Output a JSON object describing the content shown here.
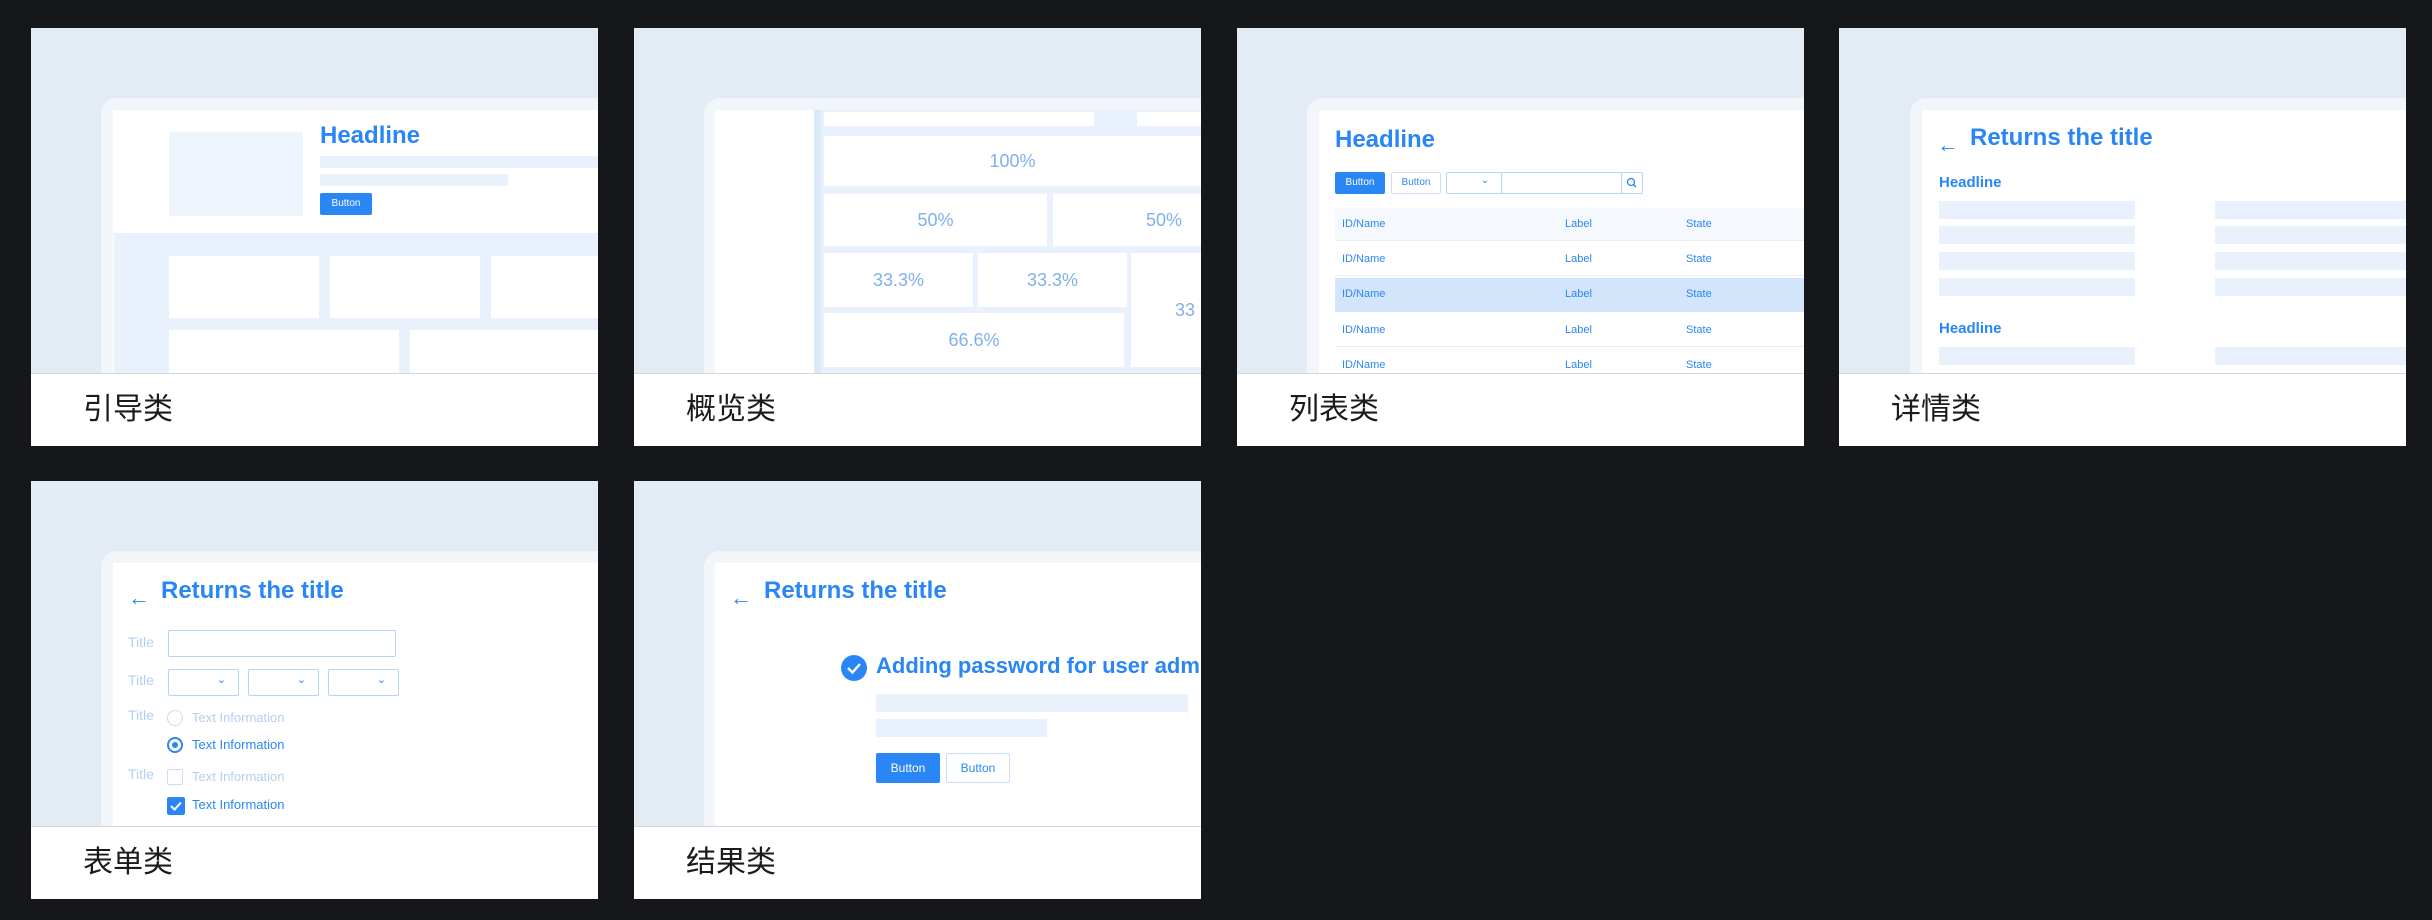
{
  "cards": [
    {
      "label": "引导类",
      "headline": "Headline",
      "button": "Button"
    },
    {
      "label": "概览类",
      "cells": {
        "full": "100%",
        "half_a": "50%",
        "half_b": "50%",
        "third_a": "33.3%",
        "third_b": "33.3%",
        "third_c": "33",
        "two_thirds": "66.6%"
      }
    },
    {
      "label": "列表类",
      "headline": "Headline",
      "button_primary": "Button",
      "button_secondary": "Button",
      "columns": [
        "ID/Name",
        "Label",
        "State"
      ],
      "rows": [
        [
          "ID/Name",
          "Label",
          "State"
        ],
        [
          "ID/Name",
          "Label",
          "State"
        ],
        [
          "ID/Name",
          "Label",
          "State"
        ],
        [
          "ID/Name",
          "Label",
          "State"
        ]
      ]
    },
    {
      "label": "详情类",
      "title": "Returns the title",
      "section1": "Headline",
      "section2": "Headline"
    },
    {
      "label": "表单类",
      "title": "Returns the title",
      "field_label": "Title",
      "option_text": "Text Information"
    },
    {
      "label": "结果类",
      "title": "Returns the title",
      "message": "Adding password for user admin",
      "button_primary": "Button",
      "button_secondary": "Button"
    }
  ],
  "colors": {
    "background": "#16171b",
    "accent": "#2a86f5",
    "light_fill": "#e8f1fc"
  }
}
